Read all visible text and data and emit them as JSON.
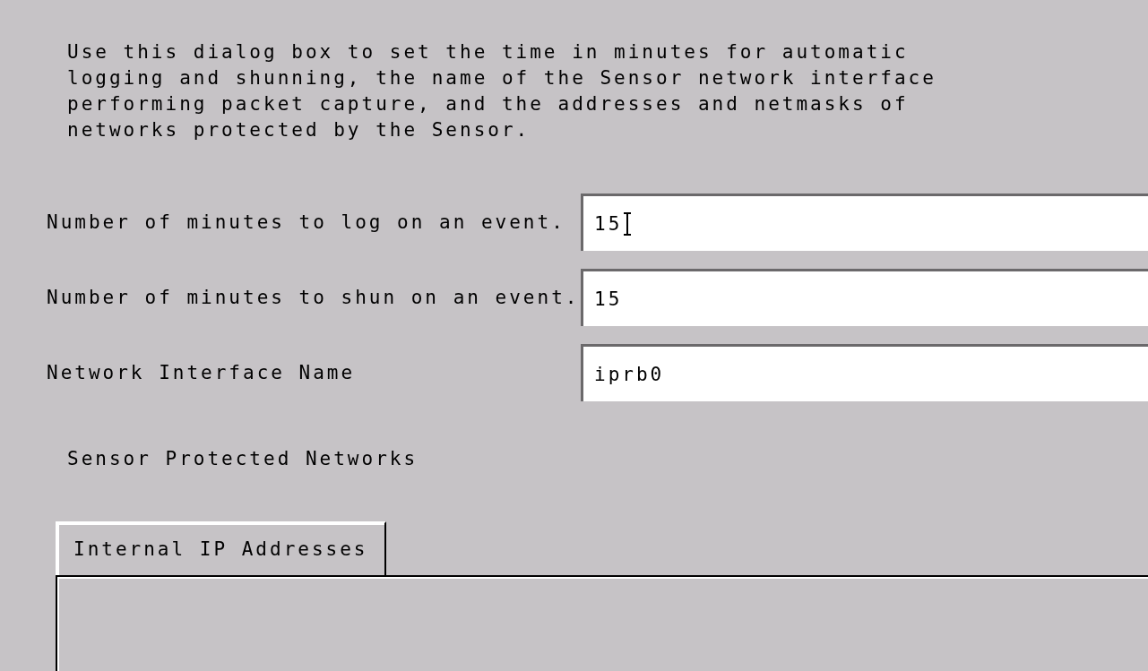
{
  "description": "Use this dialog box to set the time in minutes for automatic logging and shunning, the name of the Sensor network interface performing packet capture, and the addresses and netmasks of networks protected by the Sensor.",
  "fields": [
    {
      "label": "Number of minutes to log on an event.",
      "value": "15",
      "focused": true
    },
    {
      "label": "Number of minutes to shun on an event.",
      "value": "15",
      "focused": false
    },
    {
      "label": "Network Interface Name",
      "value": "iprb0",
      "focused": false
    }
  ],
  "networks": {
    "title": "Sensor Protected Networks",
    "tabs": [
      {
        "label": "Internal IP Addresses",
        "selected": true
      }
    ]
  }
}
